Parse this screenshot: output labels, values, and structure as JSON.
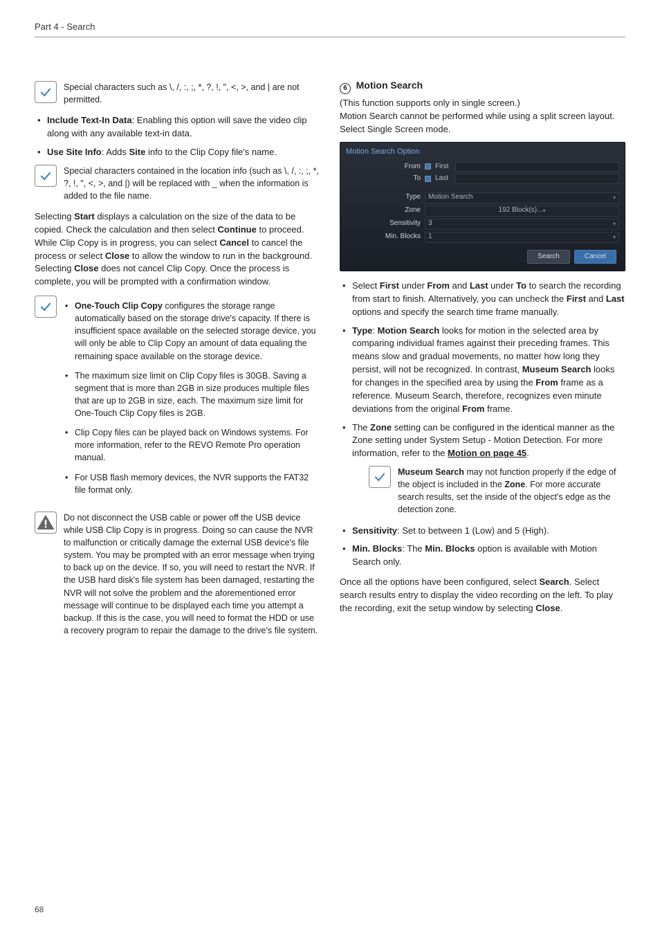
{
  "header": "Part 4 - Search",
  "page_number": "68",
  "left": {
    "note1": "Special characters such as \\, /, :, ;, *, ?, !, \", <, >, and | are not permitted.",
    "bullets1": [
      {
        "bold": "Include Text-In Data",
        "rest": ": Enabling this option will save the video clip along with any available text-in data."
      },
      {
        "bold": "Use Site Info",
        "rest": ": Adds ",
        "bold2": "Site",
        "rest2": " info to the Clip Copy file's name."
      }
    ],
    "note2": "Special characters contained in the location info (such as \\, /, :, ;, *, ?, !, \", <, >, and |) will be replaced with _ when the information is added to the file name.",
    "para1_a": "Selecting ",
    "para1_b": "Start",
    "para1_c": " displays a calculation on the size of the data to be copied. Check the calculation and then select ",
    "para1_d": "Continue",
    "para1_e": " to proceed. While Clip Copy is in progress, you can select ",
    "para1_f": "Cancel",
    "para1_g": " to cancel the process or select ",
    "para1_h": "Close",
    "para1_i": " to allow the window to run in the background. Selecting ",
    "para1_j": "Close",
    "para1_k": " does not cancel Clip Copy. Once the process is complete, you will be prompted with a confirmation window.",
    "sub1_bold": "One-Touch Clip Copy",
    "sub1_rest": " configures the storage range automatically based on the storage drive's capacity. If there is insufficient space available on the selected storage device, you will only be able to Clip Copy an amount of data equaling the remaining space available on the storage device.",
    "sub2": "The maximum size limit on Clip Copy files is 30GB. Saving a segment that is more than 2GB in size produces multiple files that are up to 2GB in size, each. The maximum size limit for One-Touch Clip Copy files is 2GB.",
    "sub3": "Clip Copy files can be played back on Windows systems. For more information, refer to the REVO Remote Pro operation manual.",
    "sub4": "For USB flash memory devices, the NVR supports the FAT32 file format only.",
    "warn": "Do not disconnect the USB cable or power off the USB device while USB Clip Copy is in progress. Doing so can cause the NVR to malfunction or critically damage the external USB device's file system. You may be prompted with an error message when trying to back up on the device. If so, you will need to restart the NVR. If the USB hard disk's file system has been damaged, restarting the NVR will not solve the problem and the aforementioned error message will continue to be displayed each time you attempt a backup. If this is the case, you will need to format the HDD or use a recovery program to repair the damage to the drive's file system."
  },
  "right": {
    "section_num": "6",
    "section_title": "Motion Search",
    "intro1": "(This function supports only in single screen.)",
    "intro2": "Motion Search cannot be performed while using a split screen layout. Select Single Screen mode.",
    "ss": {
      "title": "Motion Search Option",
      "from_label": "From",
      "first": "First",
      "to_label": "To",
      "last": "Last",
      "type_label": "Type",
      "type_val": "Motion Search",
      "zone_label": "Zone",
      "zone_val": "192 Block(s)...",
      "sens_label": "Sensitivity",
      "sens_val": "3",
      "min_label": "Min. Blocks",
      "min_val": "1",
      "search_btn": "Search",
      "cancel_btn": "Cancel"
    },
    "b1_a": "Select ",
    "b1_b": "First",
    "b1_c": " under ",
    "b1_d": "From",
    "b1_e": " and ",
    "b1_f": "Last",
    "b1_g": " under ",
    "b1_h": "To",
    "b1_i": " to search the recording from start to finish. Alternatively, you can uncheck the ",
    "b1_j": "First",
    "b1_k": " and ",
    "b1_l": "Last",
    "b1_m": " options and specify the search time frame manually.",
    "b2_a": "Type",
    "b2_b": ": ",
    "b2_c": "Motion Search",
    "b2_d": " looks for motion in the selected area by comparing individual frames against their preceding frames. This means slow and gradual movements, no matter how long they persist, will not be recognized. In contrast, ",
    "b2_e": "Museum Search",
    "b2_f": " looks for changes in the specified area by using the ",
    "b2_g": "From",
    "b2_h": " frame as a reference. Museum Search, therefore, recognizes even minute deviations from the original ",
    "b2_i": "From",
    "b2_j": " frame.",
    "b3_a": "The ",
    "b3_b": "Zone",
    "b3_c": " setting can be configured in the identical manner as the Zone setting under System Setup - Motion Detection. For more information, refer to the ",
    "b3_d": "Motion on page 45",
    "b3_e": ".",
    "note_a": "Museum Search",
    "note_b": " may not function properly if the edge of the object is included in the ",
    "note_c": "Zone",
    "note_d": ". For more accurate search results, set the inside of the object's edge as the detection zone.",
    "b4_a": "Sensitivity",
    "b4_b": ": Set to between 1 (Low) and 5 (High).",
    "b5_a": "Min. Blocks",
    "b5_b": ": The ",
    "b5_c": "Min. Blocks",
    "b5_d": " option is available with Motion Search only.",
    "para2_a": "Once all the options have been configured, select ",
    "para2_b": "Search",
    "para2_c": ". Select search results entry to display the video recording on the left. To play the recording, exit the setup window by selecting ",
    "para2_d": "Close",
    "para2_e": "."
  }
}
